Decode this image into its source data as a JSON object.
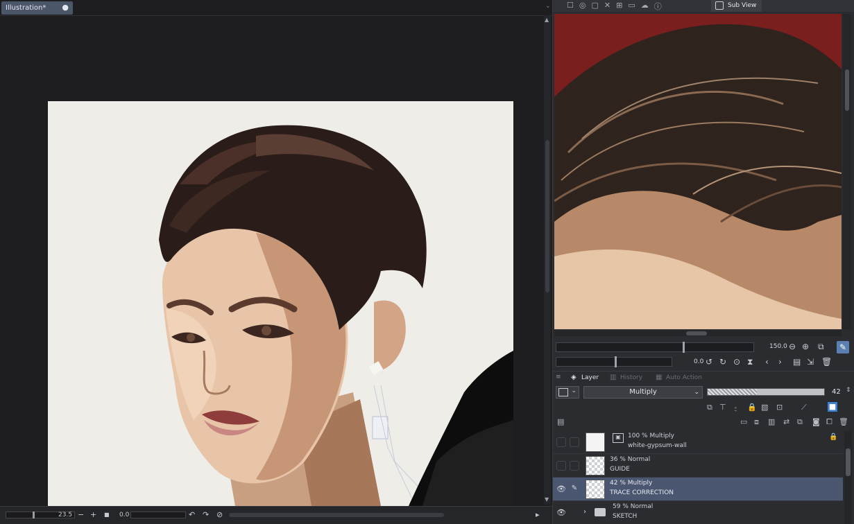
{
  "canvas": {
    "doc_tab_label": "Illustration*",
    "doc_tab_close": "●",
    "zoom_value": "23.5",
    "rotation_value": "0.0"
  },
  "subview": {
    "tab_label": "Sub View",
    "zoom_value": "150.0",
    "rotation_value": "0.0"
  },
  "layer_panel": {
    "tabs": [
      {
        "label": "Layer",
        "active": true
      },
      {
        "label": "History",
        "active": false
      },
      {
        "label": "Auto Action",
        "active": false
      }
    ],
    "blend_mode": "Multiply",
    "opacity": "42",
    "opacity_fraction": 0.42,
    "layers": [
      {
        "line1": "100 % Multiply",
        "line2": "white-gypsum-wall",
        "visible": false,
        "selected": false,
        "locked": true,
        "type": "image"
      },
      {
        "line1": "36 % Normal",
        "line2": "GUIDE",
        "visible": false,
        "selected": false,
        "locked": false,
        "type": "raster"
      },
      {
        "line1": "42 % Multiply",
        "line2": "TRACE CORRECTION",
        "visible": true,
        "selected": true,
        "locked": false,
        "type": "raster"
      },
      {
        "line1": "59 % Normal",
        "line2": "SKETCH",
        "visible": true,
        "selected": false,
        "locked": false,
        "type": "folder"
      }
    ]
  },
  "colors": {
    "accent": "#4b5670",
    "tab_active": "#4b5669",
    "paper": "#efede8",
    "subview_bg": "#7a1e1e"
  }
}
